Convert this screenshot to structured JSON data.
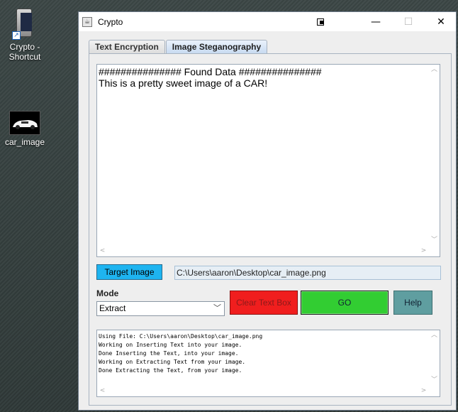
{
  "desktop": {
    "icons": [
      {
        "label": "Crypto - Shortcut"
      },
      {
        "label": "car_image"
      }
    ]
  },
  "window": {
    "title": "Crypto",
    "controls": {
      "minimize": "—",
      "maximize": "☐",
      "close": "✕"
    }
  },
  "tabs": [
    {
      "label": "Text Encryption",
      "active": false
    },
    {
      "label": "Image Steganography",
      "active": true
    }
  ],
  "main_text": "############### Found Data ###############\nThis is a pretty sweet image of a CAR!",
  "target_button": "Target Image",
  "target_path": "C:\\Users\\aaron\\Desktop\\car_image.png",
  "mode": {
    "label": "Mode",
    "selected": "Extract"
  },
  "buttons": {
    "clear": "Clear Text Box",
    "go": "GO",
    "help": "Help"
  },
  "colors": {
    "target": "#1eb4f0",
    "clear": "#f01e1e",
    "go": "#32cd32",
    "help": "#5f9ea0"
  },
  "log": "Using File: C:\\Users\\aaron\\Desktop\\car_image.png\nWorking on Inserting Text into your image.\nDone Inserting the Text, into your image.\nWorking on Extracting Text from your image.\nDone Extracting the Text, from your image."
}
